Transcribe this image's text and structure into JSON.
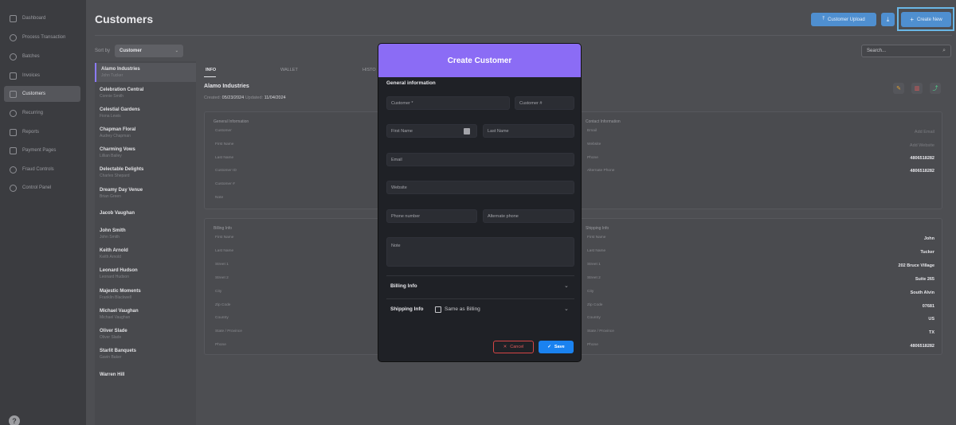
{
  "sidebar": {
    "items": [
      {
        "label": "Dashboard",
        "icon": "grid-icon"
      },
      {
        "label": "Process Transaction",
        "icon": "dollar-circle-icon"
      },
      {
        "label": "Batches",
        "icon": "batch-icon"
      },
      {
        "label": "Invoices",
        "icon": "invoice-icon"
      },
      {
        "label": "Customers",
        "icon": "customers-icon"
      },
      {
        "label": "Recurring",
        "icon": "recurring-icon"
      },
      {
        "label": "Reports",
        "icon": "reports-icon"
      },
      {
        "label": "Payment Pages",
        "icon": "payment-page-icon"
      },
      {
        "label": "Fraud Controls",
        "icon": "shield-icon"
      },
      {
        "label": "Control Panel",
        "icon": "gear-icon"
      }
    ],
    "help": "?"
  },
  "header": {
    "title": "Customers",
    "upload_label": "Customer Upload",
    "create_label": "Create New"
  },
  "sort": {
    "label": "Sort by",
    "value": "Customer"
  },
  "search": {
    "placeholder": "Search..."
  },
  "customers": [
    {
      "name": "Alamo Industries",
      "contact": "John Tucker"
    },
    {
      "name": "Celebration Central",
      "contact": "Connie Smith"
    },
    {
      "name": "Celestial Gardens",
      "contact": "Fiona Lewis"
    },
    {
      "name": "Chapman Floral",
      "contact": "Audrey Chapman"
    },
    {
      "name": "Charming Vows",
      "contact": "Lillian Bailey"
    },
    {
      "name": "Delectable Delights",
      "contact": "Charles Shepard"
    },
    {
      "name": "Dreamy Day Venue",
      "contact": "Brian Green"
    },
    {
      "name": "Jacob Vaughan",
      "contact": ""
    },
    {
      "name": "John Smith",
      "contact": "John Smith"
    },
    {
      "name": "Keith Arnold",
      "contact": "Keith Arnold"
    },
    {
      "name": "Leonard Hudson",
      "contact": "Leonard Hudson"
    },
    {
      "name": "Majestic Moments",
      "contact": "Franklin Blackwell"
    },
    {
      "name": "Michael Vaughan",
      "contact": "Michael Vaughan"
    },
    {
      "name": "Oliver Slade",
      "contact": "Oliver Slade"
    },
    {
      "name": "Starlit Banquets",
      "contact": "Gavin Baker"
    },
    {
      "name": "Warren Hill",
      "contact": ""
    }
  ],
  "detail": {
    "tabs": [
      "INFO",
      "WALLET",
      "HISTO"
    ],
    "title": "Alamo Industries",
    "created_label": "Created:",
    "created": "05/23/2024",
    "updated_label": "Updated:",
    "updated": "11/04/2024",
    "general": {
      "title": "General Information",
      "labels": [
        "Customer",
        "First Name",
        "Last Name",
        "Customer ID",
        "Customer #",
        "Note"
      ]
    },
    "contact": {
      "title": "Contact Information",
      "rows": [
        {
          "label": "Email",
          "value": "Add Email"
        },
        {
          "label": "Website",
          "value": "Add Website"
        },
        {
          "label": "Phone",
          "value": "4806518282"
        },
        {
          "label": "Alternate Phone",
          "value": "4806518282"
        }
      ]
    },
    "billing": {
      "title": "Billing Info",
      "labels": [
        "First Name",
        "Last Name",
        "Street 1",
        "Street 2",
        "City",
        "Zip Code",
        "Country",
        "State / Province",
        "Phone"
      ]
    },
    "shipping": {
      "title": "Shipping Info",
      "rows": [
        {
          "label": "First Name",
          "value": "John"
        },
        {
          "label": "Last Name",
          "value": "Tucker"
        },
        {
          "label": "Street 1",
          "value": "202 Bruce Village"
        },
        {
          "label": "Street 2",
          "value": "Suite 265"
        },
        {
          "label": "City",
          "value": "South Alvin"
        },
        {
          "label": "Zip Code",
          "value": "07681"
        },
        {
          "label": "Country",
          "value": "US"
        },
        {
          "label": "State / Province",
          "value": "TX"
        },
        {
          "label": "Phone",
          "value": "4806518282"
        }
      ]
    }
  },
  "modal": {
    "title": "Create Customer",
    "section": "General information",
    "fields": {
      "customer": "Customer *",
      "customer_num": "Customer #",
      "first_name": "First Name",
      "last_name": "Last Name",
      "email": "Email",
      "website": "Website",
      "phone": "Phone number",
      "alt_phone": "Alternate phone",
      "note": "Note"
    },
    "billing_label": "Billing Info",
    "shipping_label": "Shipping Info",
    "same_as_billing": "Same as Billing",
    "cancel_label": "Cancel",
    "save_label": "Save"
  }
}
